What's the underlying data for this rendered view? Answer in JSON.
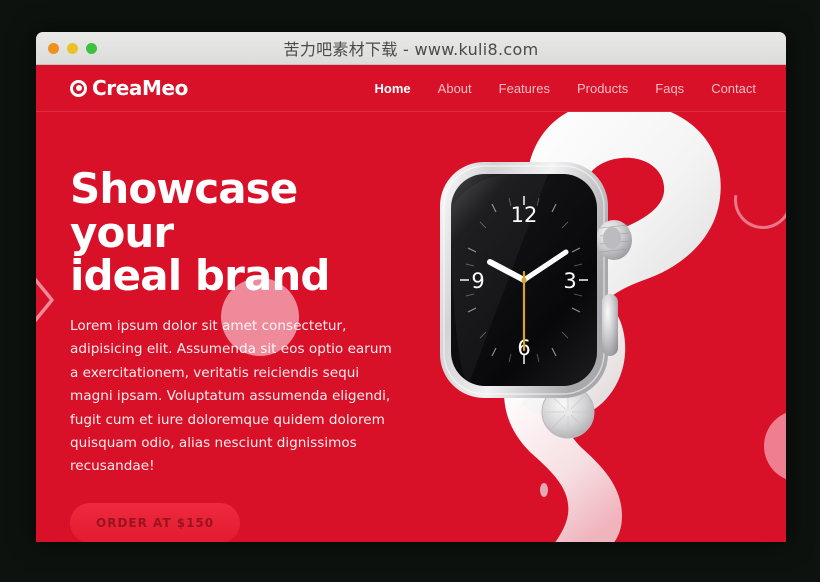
{
  "window": {
    "title": "苦力吧素材下载 - www.kuli8.com",
    "controls": [
      {
        "name": "close",
        "color": "#f0901e"
      },
      {
        "name": "minimize",
        "color": "#ebc12a"
      },
      {
        "name": "maximize",
        "color": "#3ec13e"
      }
    ]
  },
  "site": {
    "brand": {
      "name": "CreaMeo",
      "icon": "target-icon"
    },
    "nav": [
      {
        "label": "Home",
        "active": true
      },
      {
        "label": "About",
        "active": false
      },
      {
        "label": "Features",
        "active": false
      },
      {
        "label": "Products",
        "active": false
      },
      {
        "label": "Faqs",
        "active": false
      },
      {
        "label": "Contact",
        "active": false
      }
    ],
    "hero": {
      "title_line1": "Showcase your",
      "title_line2": "ideal brand",
      "paragraph": "Lorem ipsum dolor sit amet consectetur, adipisicing elit. Assumenda sit eos optio earum a exercitationem, veritatis reiciendis sequi magni ipsam. Voluptatum assumenda eligendi, fugit cum et iure doloremque quidem dolorem quisquam odio, alias nesciunt dignissimos recusandae!",
      "cta_label": "ORDER AT $150",
      "product_image": "apple-watch-white-band",
      "watch_face": {
        "numerals": [
          "12",
          "3",
          "6",
          "9"
        ],
        "time": "10:10"
      }
    },
    "colors": {
      "background_red": "#d81129",
      "accent_pink": "#ef8a9a",
      "button_red": "#ee2a3e",
      "text_white": "#ffffff"
    },
    "slider": {
      "prev_icon": "chevron-left-icon"
    },
    "decorations": [
      "circle-behind-heading",
      "open-ring-top-right",
      "circle-right-edge"
    ]
  }
}
